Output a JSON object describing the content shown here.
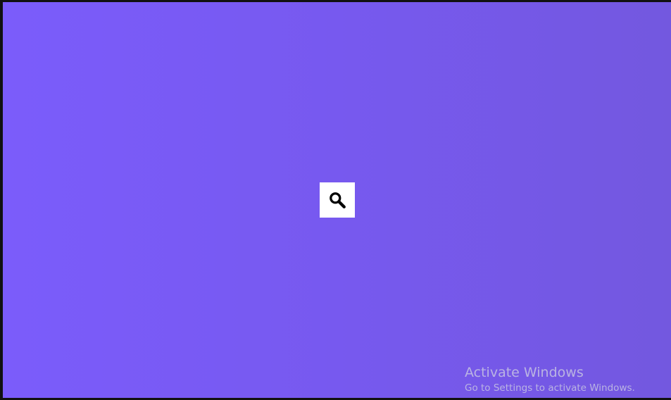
{
  "background": {
    "gradient_start": "#7b5cfb",
    "gradient_end": "#7358df"
  },
  "search": {
    "icon": "search-icon",
    "button_background": "#ffffff"
  },
  "watermark": {
    "title": "Activate Windows",
    "subtitle": "Go to Settings to activate Windows."
  }
}
